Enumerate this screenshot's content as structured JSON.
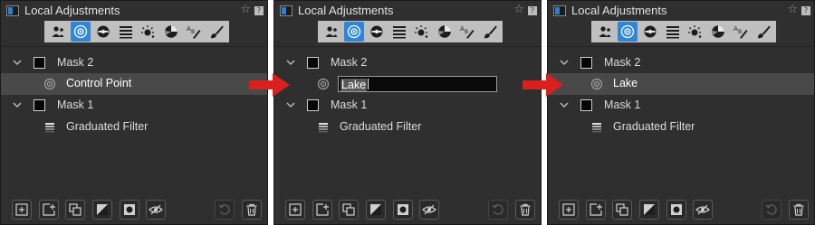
{
  "colors": {
    "panel_bg": "#2f2f2f",
    "accent": "#2f86d8",
    "arrow": "#d9201e"
  },
  "tools": [
    "portrait-icon",
    "control-point-icon",
    "exposure-icon",
    "levels-icon",
    "clarity-icon",
    "color-wheel-icon",
    "ab-brush-icon",
    "brush-icon"
  ],
  "active_tool": "control-point-icon",
  "arrows": [
    "right-arrow",
    "right-arrow"
  ],
  "panels": [
    {
      "title": "Local Adjustments",
      "star": "☆",
      "help": "?",
      "mask2": "Mask 2",
      "mask2_layer": "Control Point",
      "mask1": "Mask 1",
      "mask1_layer": "Graduated Filter",
      "state": "selected"
    },
    {
      "title": "Local Adjustments",
      "star": "☆",
      "help": "?",
      "mask2": "Mask 2",
      "edit_value": "Lake",
      "mask1": "Mask 1",
      "mask1_layer": "Graduated Filter",
      "state": "editing"
    },
    {
      "title": "Local Adjustments",
      "star": "☆",
      "help": "?",
      "mask2": "Mask 2",
      "mask2_layer": "Lake",
      "mask1": "Mask 1",
      "mask1_layer": "Graduated Filter",
      "state": "selected"
    }
  ],
  "bottom_buttons": [
    "add-mask-icon",
    "add-layer-icon",
    "duplicate-icon",
    "invert-icon",
    "mask-circle-icon",
    "hide-eye-icon",
    "undo-icon",
    "trash-icon"
  ]
}
